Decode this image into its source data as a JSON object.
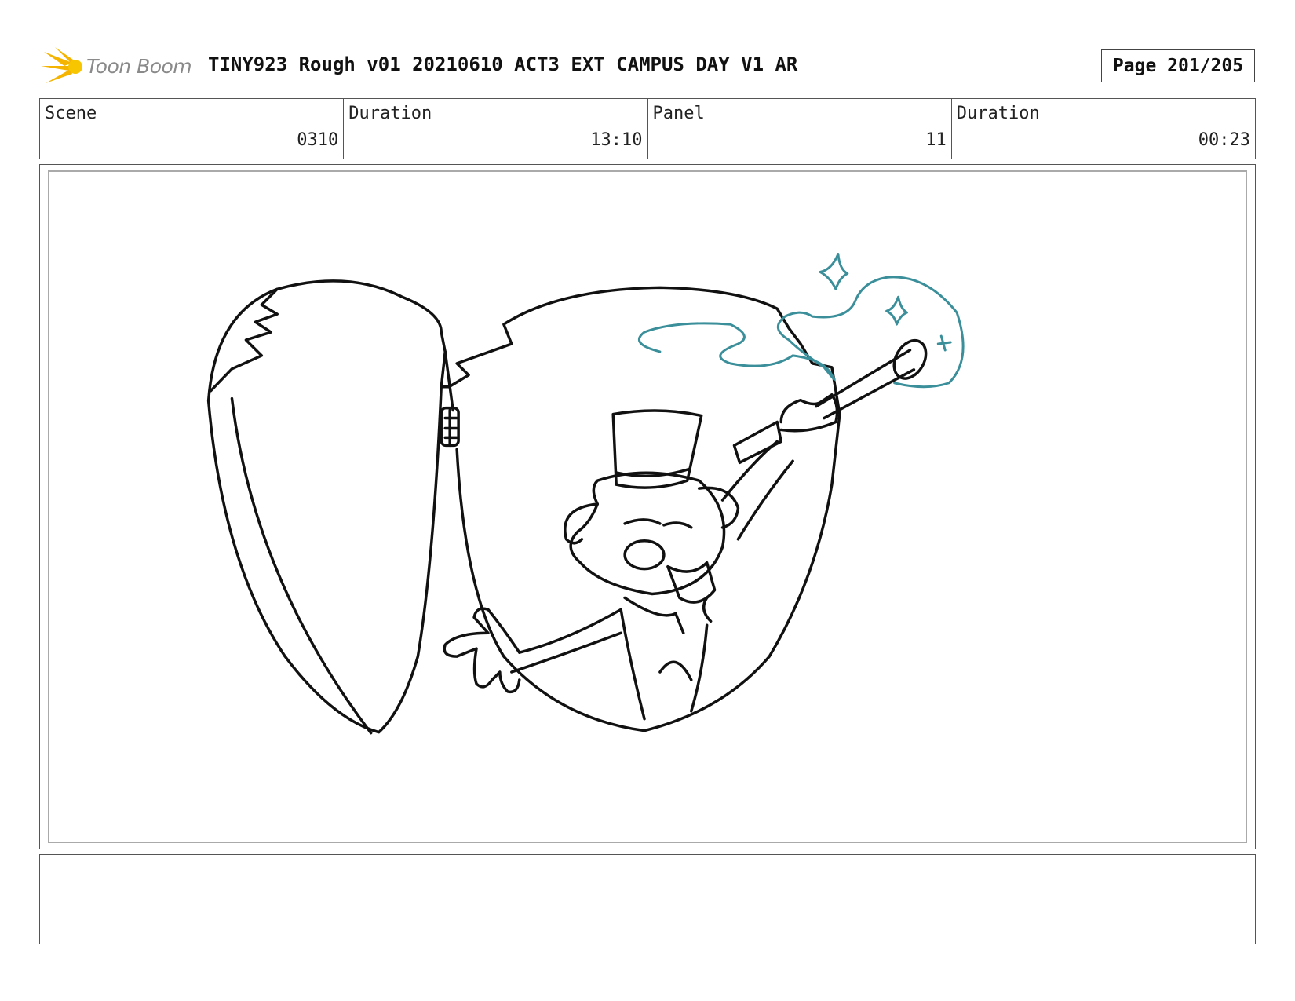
{
  "header": {
    "logo_text": "Toon Boom",
    "title": "TINY923 Rough v01 20210610 ACT3 EXT CAMPUS DAY V1 AR",
    "page": "Page 201/205"
  },
  "info": {
    "scene_label": "Scene",
    "scene_value": "0310",
    "scene_duration_label": "Duration",
    "scene_duration_value": "13:10",
    "panel_label": "Panel",
    "panel_value": "11",
    "panel_duration_label": "Duration",
    "panel_duration_value": "00:23"
  },
  "notes": "",
  "colors": {
    "logo_accent": "#f5b400",
    "magic_swirl": "#3a8f9a",
    "line_art": "#111111"
  }
}
